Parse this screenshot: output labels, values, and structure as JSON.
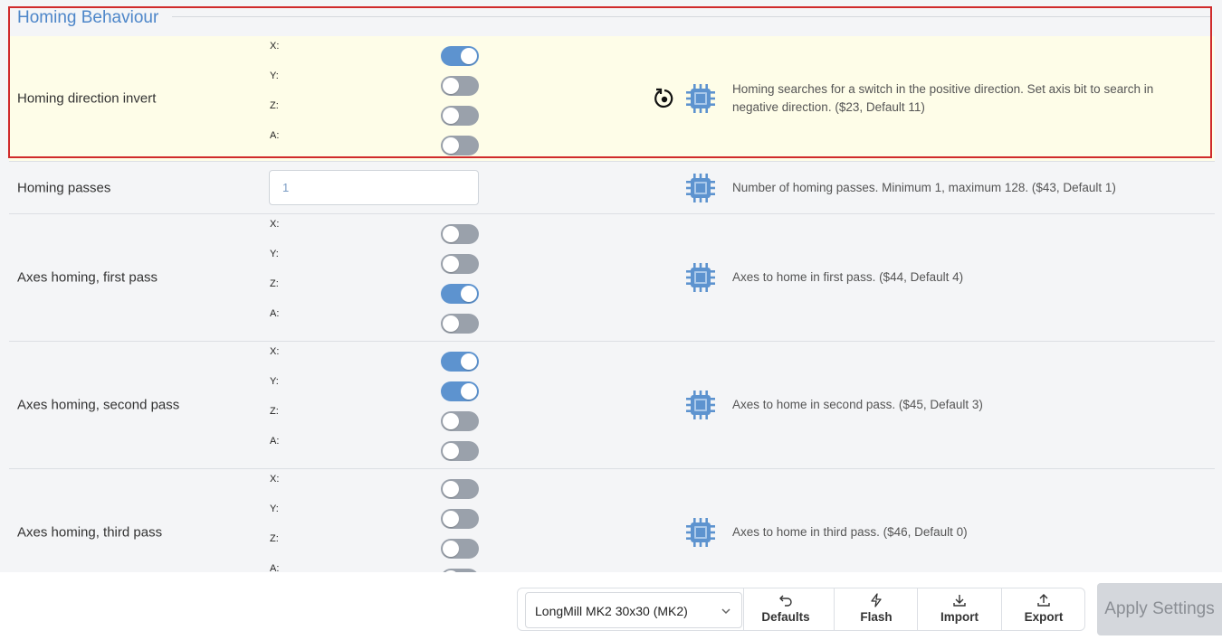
{
  "section": {
    "title": "Homing Behaviour"
  },
  "rows": [
    {
      "label": "Homing direction invert",
      "type": "axes",
      "highlighted": true,
      "has_reset": true,
      "axes": [
        {
          "letter": "X:",
          "on": true
        },
        {
          "letter": "Y:",
          "on": false
        },
        {
          "letter": "Z:",
          "on": false
        },
        {
          "letter": "A:",
          "on": false
        }
      ],
      "description": "Homing searches for a switch in the positive direction. Set axis bit to search in negative direction. ($23, Default 11)"
    },
    {
      "label": "Homing passes",
      "type": "number",
      "value": "1",
      "description": "Number of homing passes. Minimum 1, maximum 128. ($43, Default 1)"
    },
    {
      "label": "Axes homing, first pass",
      "type": "axes",
      "axes": [
        {
          "letter": "X:",
          "on": false
        },
        {
          "letter": "Y:",
          "on": false
        },
        {
          "letter": "Z:",
          "on": true
        },
        {
          "letter": "A:",
          "on": false
        }
      ],
      "description": "Axes to home in first pass. ($44, Default 4)"
    },
    {
      "label": "Axes homing, second pass",
      "type": "axes",
      "axes": [
        {
          "letter": "X:",
          "on": true
        },
        {
          "letter": "Y:",
          "on": true
        },
        {
          "letter": "Z:",
          "on": false
        },
        {
          "letter": "A:",
          "on": false
        }
      ],
      "description": "Axes to home in second pass. ($45, Default 3)"
    },
    {
      "label": "Axes homing, third pass",
      "type": "axes",
      "axes": [
        {
          "letter": "X:",
          "on": false
        },
        {
          "letter": "Y:",
          "on": false
        },
        {
          "letter": "Z:",
          "on": false
        },
        {
          "letter": "A:",
          "on": false
        }
      ],
      "description": "Axes to home in third pass. ($46, Default 0)"
    }
  ],
  "toolbar": {
    "profile_select": "LongMill MK2 30x30 (MK2)",
    "defaults_label": "Defaults",
    "flash_label": "Flash",
    "import_label": "Import",
    "export_label": "Export",
    "apply_label": "Apply Settings"
  },
  "colors": {
    "accent": "#5d93cf",
    "toggle_off": "#9aa1ab",
    "highlight_bg": "#fefde8",
    "highlight_border": "#d02b2b"
  },
  "icons": {
    "reset": "reset-icon",
    "chip": "chip-icon"
  }
}
